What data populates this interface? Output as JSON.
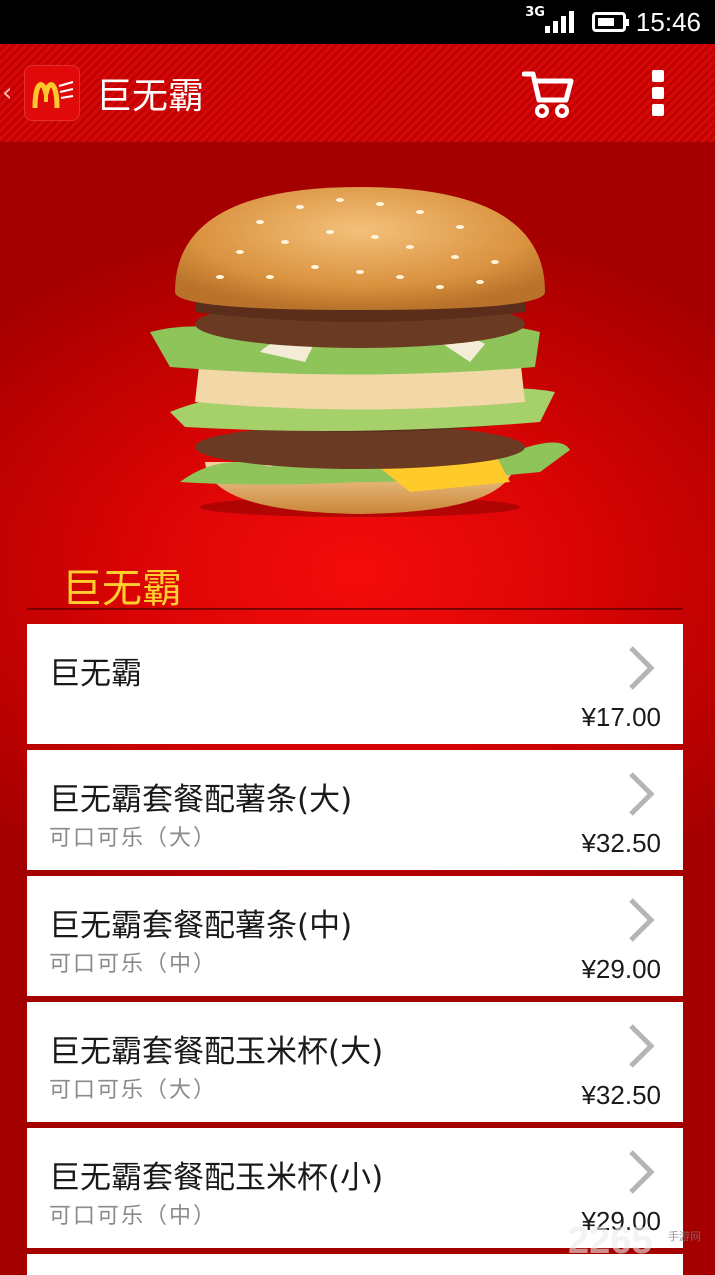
{
  "status_bar": {
    "network": "3G",
    "time": "15:46"
  },
  "app_bar": {
    "back_glyph": "‹",
    "title": "巨无霸",
    "icons": [
      "back-icon",
      "mcdonalds-logo-icon",
      "cart-icon",
      "overflow-menu-icon"
    ]
  },
  "hero": {
    "section_title": "巨无霸"
  },
  "menu_items": [
    {
      "name": "巨无霸",
      "sub": "",
      "price": "¥17.00"
    },
    {
      "name": "巨无霸套餐配薯条(大)",
      "sub": "可口可乐（大）",
      "price": "¥32.50"
    },
    {
      "name": "巨无霸套餐配薯条(中)",
      "sub": "可口可乐（中）",
      "price": "¥29.00"
    },
    {
      "name": "巨无霸套餐配玉米杯(大)",
      "sub": "可口可乐（大）",
      "price": "¥32.50"
    },
    {
      "name": "巨无霸套餐配玉米杯(小)",
      "sub": "可口可乐（中）",
      "price": "¥29.00"
    }
  ],
  "watermark": {
    "text": "2265",
    "small": "手游网"
  },
  "colors": {
    "app_bar": "#c20000",
    "background": "#b70000",
    "section_title": "#ffcf2e",
    "card": "#ffffff"
  }
}
